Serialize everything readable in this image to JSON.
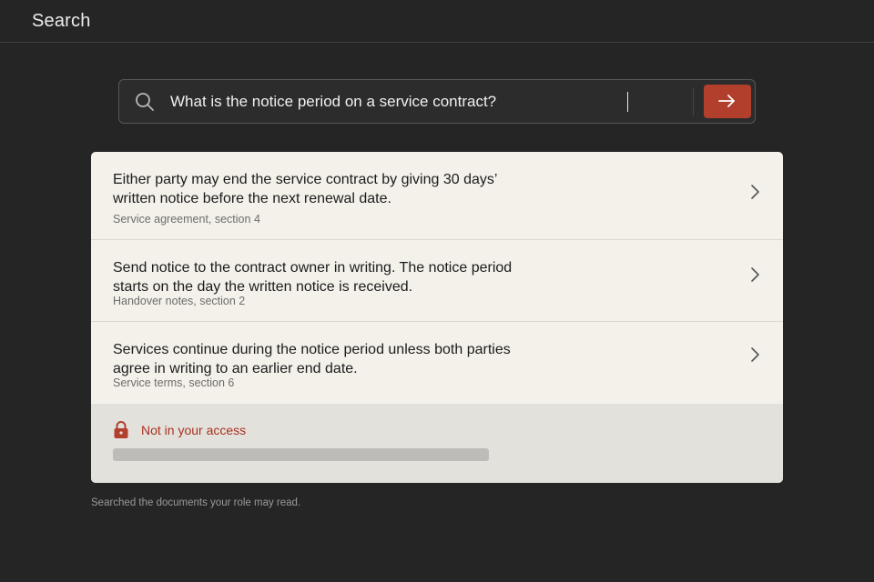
{
  "header": {
    "title": "Search"
  },
  "search": {
    "query": "What is the notice period on a service contract?",
    "icon": "search-icon",
    "submit_icon": "arrow-right-icon",
    "accent": "#b13f2c"
  },
  "results": [
    {
      "text": "Either party may end the service contract by giving 30 days’ written notice before the next renewal date.",
      "source": "Service agreement, section 4"
    },
    {
      "text": "Send notice to the contract owner in writing. The notice period starts on the day the written notice is received.",
      "source": "Handover notes, section 2"
    },
    {
      "text": "Services continue during the notice period unless both parties agree in writing to an earlier end date.",
      "source": "Service terms, section 6"
    }
  ],
  "restricted": {
    "label": "Not in your access",
    "icon": "lock-icon",
    "color": "#a7321f"
  },
  "footer": {
    "note": "Searched the documents your role may read."
  }
}
